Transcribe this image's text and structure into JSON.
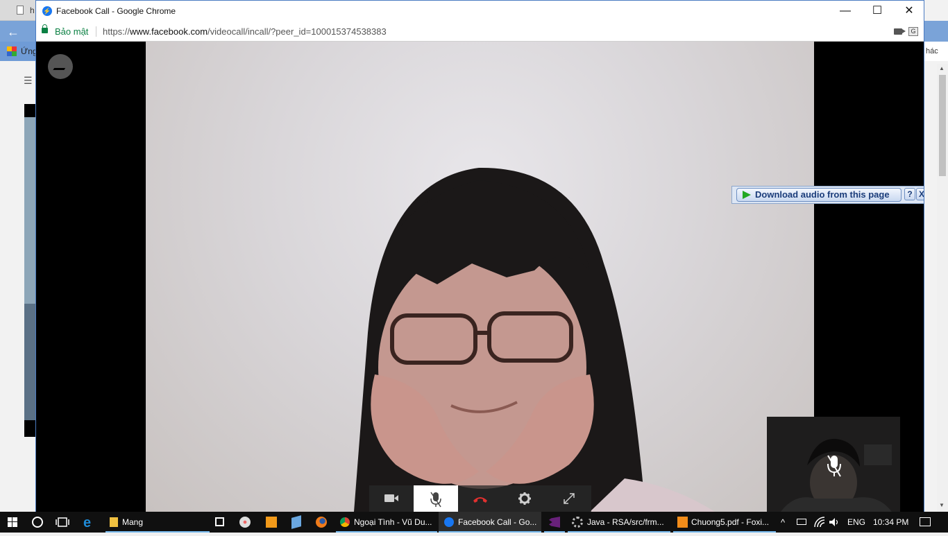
{
  "background_browser": {
    "tab_label": "h",
    "bookmark_label": "Ứng",
    "right_label": "hác"
  },
  "window": {
    "title": "Facebook Call - Google Chrome",
    "minimize": "—",
    "maximize": "☐",
    "close": "✕"
  },
  "address_bar": {
    "secure_label": "Bảo mật",
    "url_scheme": "https://",
    "url_domain": "www.facebook.com",
    "url_path": "/videocall/incall/?peer_id=100015374538383"
  },
  "download_bar": {
    "label": "Download audio from this page",
    "help": "?",
    "close": "X"
  },
  "call": {
    "controls": [
      "camera",
      "microphone-muted",
      "end-call",
      "settings",
      "fullscreen"
    ]
  },
  "taskbar": {
    "items": [
      {
        "label": "Mang"
      },
      {
        "label": "Ngoại Tình - Vũ Du..."
      },
      {
        "label": "Facebook Call - Go..."
      },
      {
        "label": "Java - RSA/src/frm..."
      },
      {
        "label": "Chuong5.pdf - Foxi..."
      }
    ],
    "language": "ENG",
    "time": "10:34 PM"
  },
  "colors": {
    "taskbar": "#101010",
    "accent": "#76b9ed",
    "secure_green": "#0b8043",
    "end_call_red": "#e0302f"
  }
}
